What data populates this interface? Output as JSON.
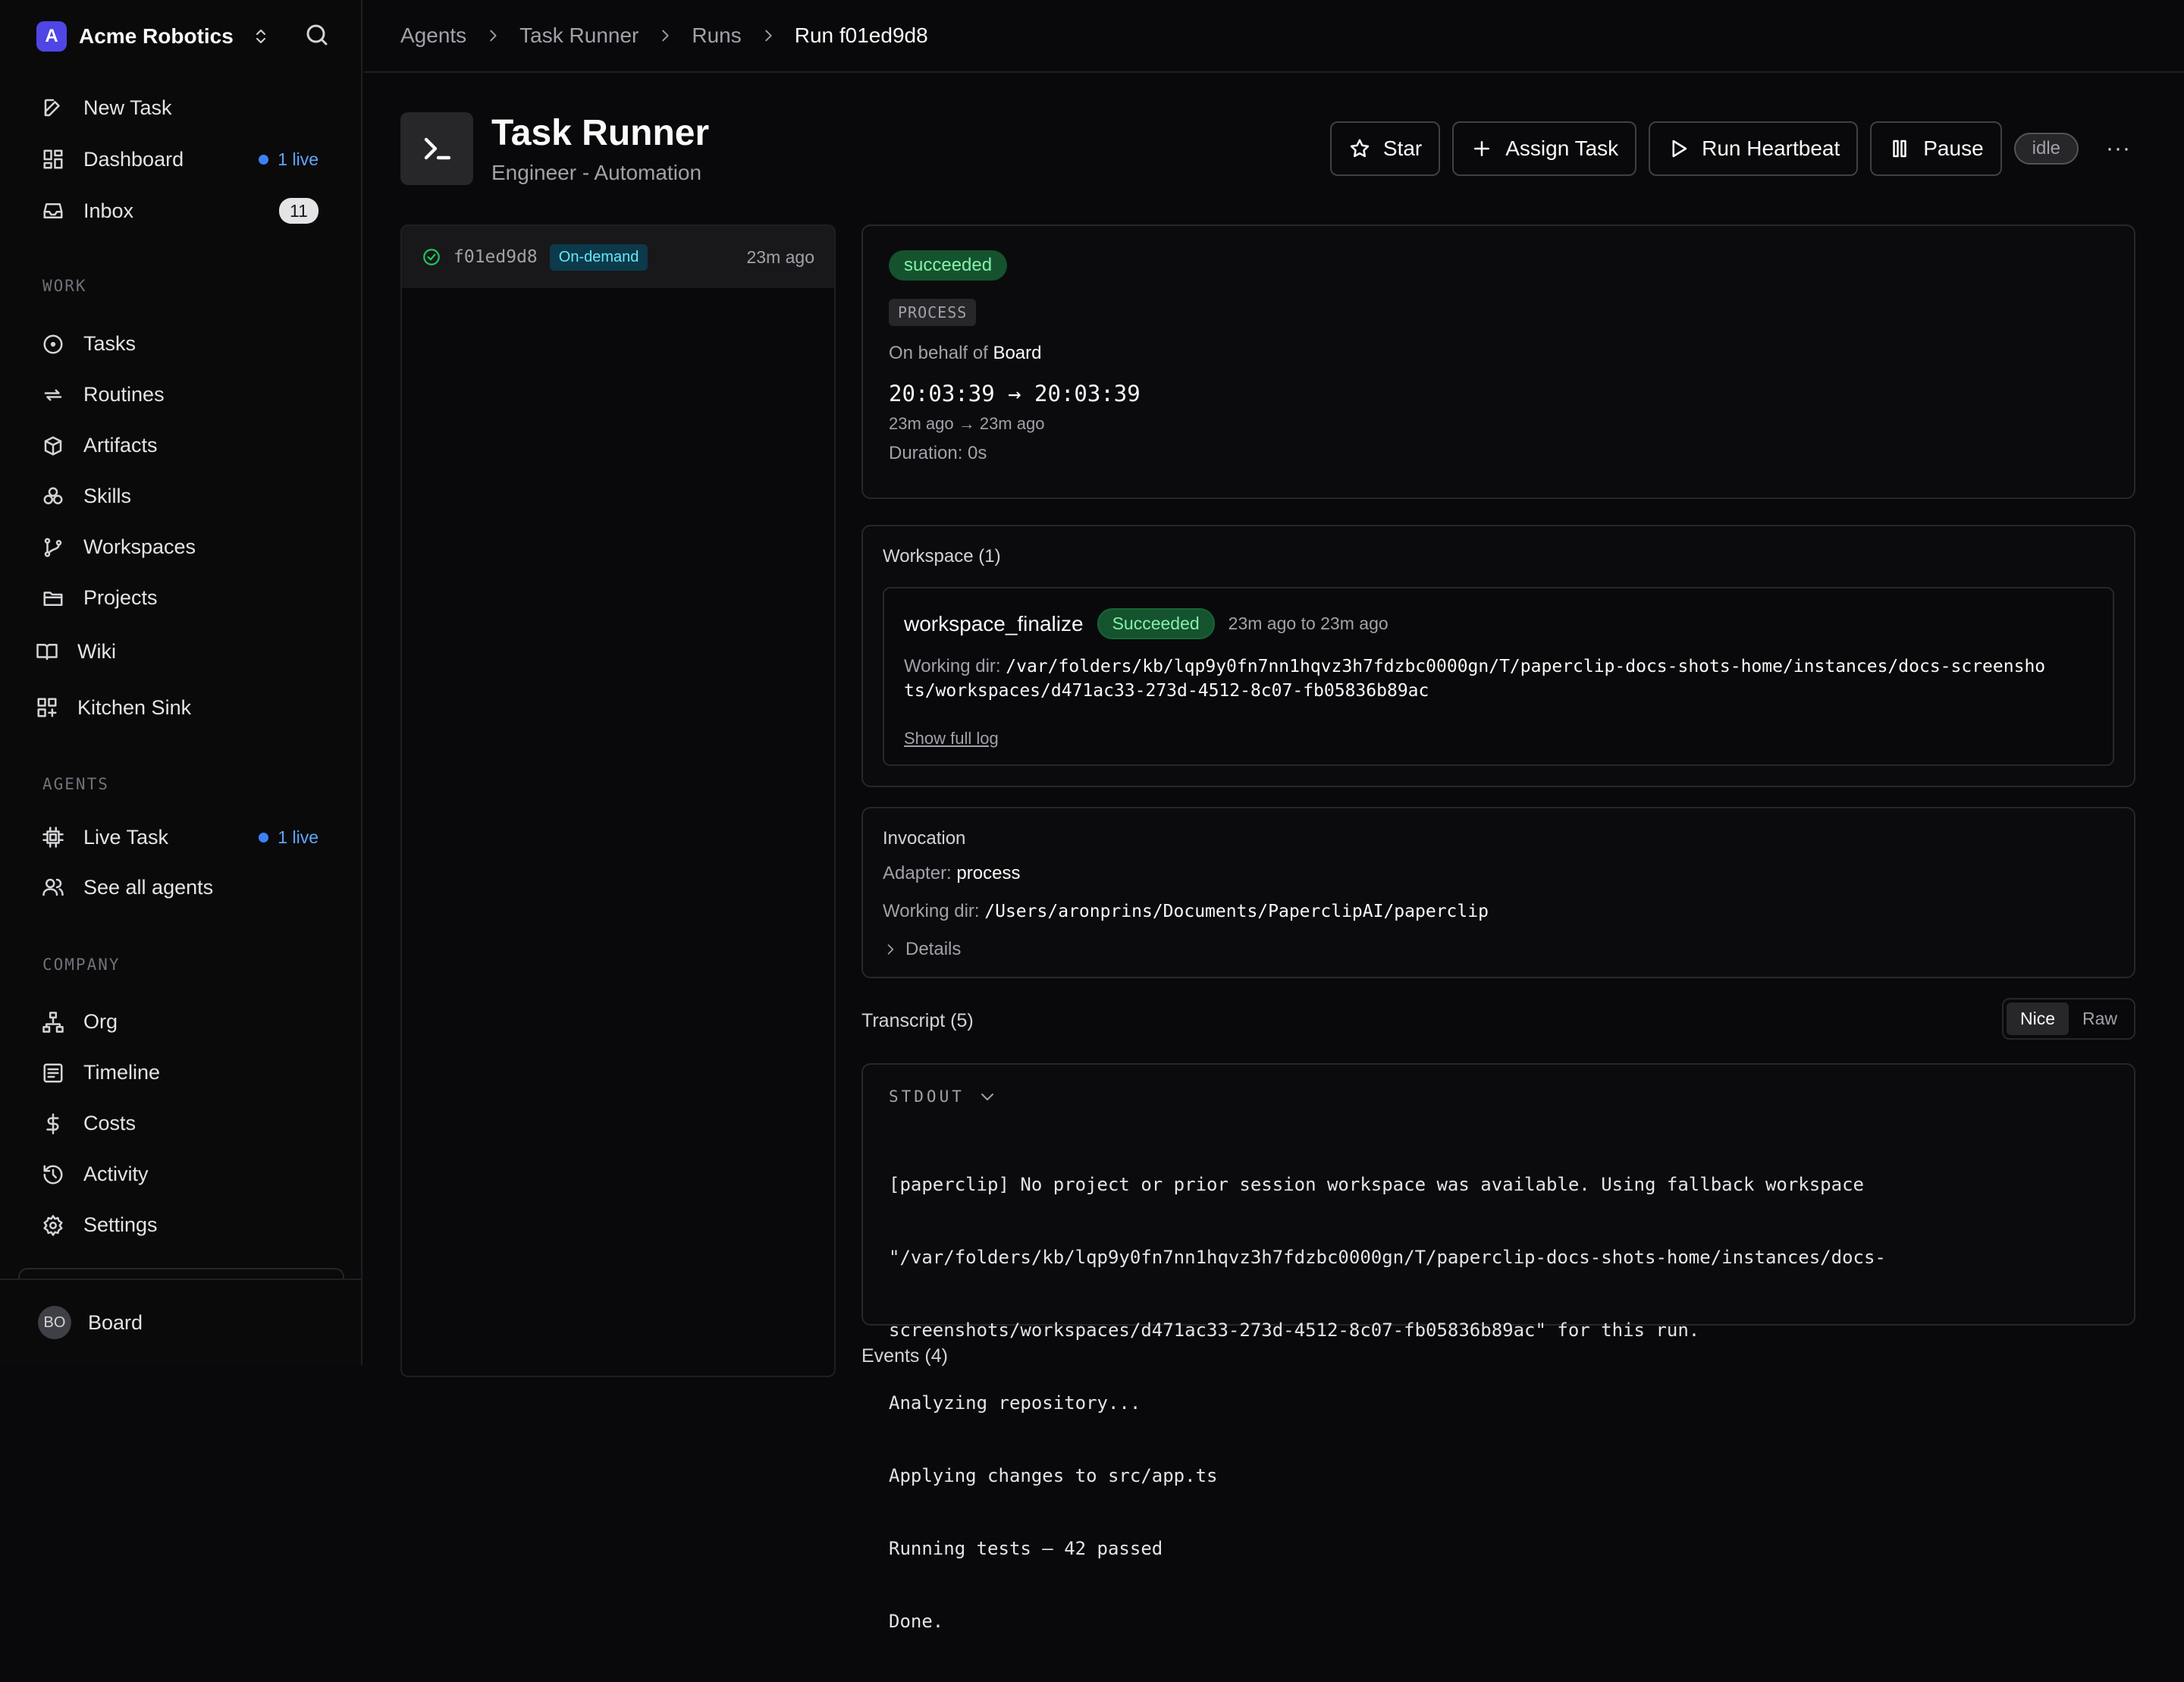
{
  "sidebar": {
    "company": "Acme Robotics",
    "company_initial": "A",
    "items_top": [
      {
        "label": "New Task"
      },
      {
        "label": "Dashboard",
        "live": "1 live"
      },
      {
        "label": "Inbox",
        "count": "11"
      }
    ],
    "work_label": "WORK",
    "work_items": [
      {
        "label": "Tasks"
      },
      {
        "label": "Routines"
      },
      {
        "label": "Artifacts"
      },
      {
        "label": "Skills"
      },
      {
        "label": "Workspaces"
      },
      {
        "label": "Projects"
      },
      {
        "label": "Wiki"
      },
      {
        "label": "Kitchen Sink"
      }
    ],
    "agents_label": "AGENTS",
    "agent_items": [
      {
        "label": "Live Task",
        "live": "1 live"
      },
      {
        "label": "See all agents"
      }
    ],
    "company_label": "COMPANY",
    "company_items": [
      {
        "label": "Org"
      },
      {
        "label": "Timeline"
      },
      {
        "label": "Costs"
      },
      {
        "label": "Activity"
      },
      {
        "label": "Settings"
      }
    ],
    "user": {
      "initials": "BO",
      "name": "Board"
    }
  },
  "breadcrumb": [
    "Agents",
    "Task Runner",
    "Runs",
    "Run f01ed9d8"
  ],
  "agent": {
    "title": "Task Runner",
    "subtitle": "Engineer - Automation",
    "actions": {
      "star": "Star",
      "assign": "Assign Task",
      "heartbeat": "Run Heartbeat",
      "pause": "Pause"
    },
    "status": "idle",
    "more": "···"
  },
  "runs": [
    {
      "id": "f01ed9d8",
      "trigger": "On-demand",
      "ago": "23m ago"
    }
  ],
  "run": {
    "status": "succeeded",
    "kind": "PROCESS",
    "behalf_prefix": "On behalf of",
    "behalf": "Board",
    "time_range": "20:03:39 → 20:03:39",
    "ago_range": "23m ago → 23m ago",
    "duration": "Duration: 0s"
  },
  "workspace": {
    "title": "Workspace (1)",
    "name": "workspace_finalize",
    "status": "Succeeded",
    "range": "23m ago to 23m ago",
    "dir_label": "Working dir:",
    "dir_line1": "/var/folders/kb/lqp9y0fn7nn1hqvz3h7fdzbc0000gn/T/paperclip-docs-shots-home/instances/docs-screensho",
    "dir_line2": "ts/workspaces/d471ac33-273d-4512-8c07-fb05836b89ac",
    "log_link": "Show full log"
  },
  "invocation": {
    "title": "Invocation",
    "adapter_label": "Adapter:",
    "adapter": "process",
    "dir_label": "Working dir:",
    "dir": "/Users/aronprins/Documents/PaperclipAI/paperclip",
    "details": "Details"
  },
  "transcript": {
    "title": "Transcript (5)",
    "modes": [
      "Nice",
      "Raw"
    ],
    "stream": "STDOUT",
    "lines": [
      "[paperclip] No project or prior session workspace was available. Using fallback workspace",
      "\"/var/folders/kb/lqp9y0fn7nn1hqvz3h7fdzbc0000gn/T/paperclip-docs-shots-home/instances/docs-",
      "screenshots/workspaces/d471ac33-273d-4512-8c07-fb05836b89ac\" for this run.",
      "Analyzing repository...",
      "Applying changes to src/app.ts",
      "Running tests — 42 passed",
      "Done."
    ]
  },
  "events": {
    "title": "Events (4)"
  }
}
